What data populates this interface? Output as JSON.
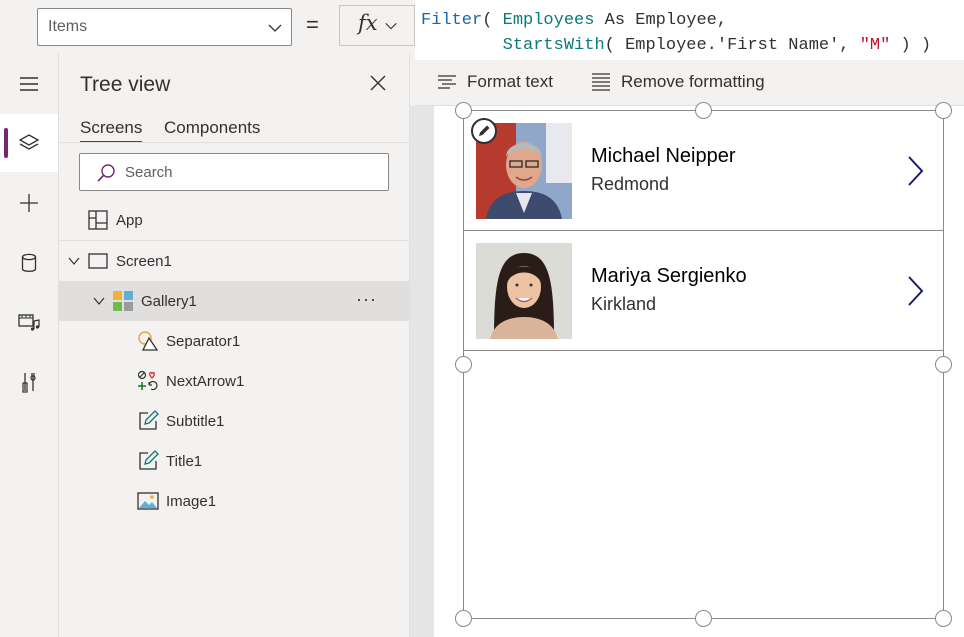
{
  "formula_bar": {
    "property": "Items",
    "equals": "=",
    "fx": "fx",
    "line1": {
      "fn": "Filter",
      "open": "( ",
      "id": "Employees",
      "rest": " As Employee,"
    },
    "line2": {
      "indent": "        ",
      "fn": "StartsWith",
      "open": "( ",
      "mid": "Employee.'First Name', ",
      "str": "\"M\"",
      "close": " ) )"
    }
  },
  "format_bar": {
    "format_text": "Format text",
    "remove_formatting": "Remove formatting"
  },
  "rail": {
    "items": [
      {
        "icon": "hamburger-icon"
      },
      {
        "icon": "layers-icon",
        "active": true
      },
      {
        "icon": "plus-icon"
      },
      {
        "icon": "database-icon"
      },
      {
        "icon": "media-icon"
      },
      {
        "icon": "tools-icon"
      }
    ]
  },
  "tree": {
    "title": "Tree view",
    "tabs": [
      "Screens",
      "Components"
    ],
    "search_placeholder": "Search",
    "nodes": [
      {
        "label": "App",
        "icon": "app-icon"
      },
      {
        "label": "Screen1",
        "icon": "screen-icon"
      },
      {
        "label": "Gallery1",
        "icon": "gallery-icon",
        "selected": true
      },
      {
        "label": "Separator1",
        "icon": "shapes-icon"
      },
      {
        "label": "NextArrow1",
        "icon": "icons-icon"
      },
      {
        "label": "Subtitle1",
        "icon": "edit-label-icon"
      },
      {
        "label": "Title1",
        "icon": "edit-label-icon"
      },
      {
        "label": "Image1",
        "icon": "image-icon"
      }
    ],
    "more": "···"
  },
  "gallery": {
    "items": [
      {
        "title": "Michael Neipper",
        "subtitle": "Redmond"
      },
      {
        "title": "Mariya Sergienko",
        "subtitle": "Kirkland"
      }
    ]
  },
  "colors": {
    "accent": "#742774",
    "arrow": "#1b1b6f"
  }
}
